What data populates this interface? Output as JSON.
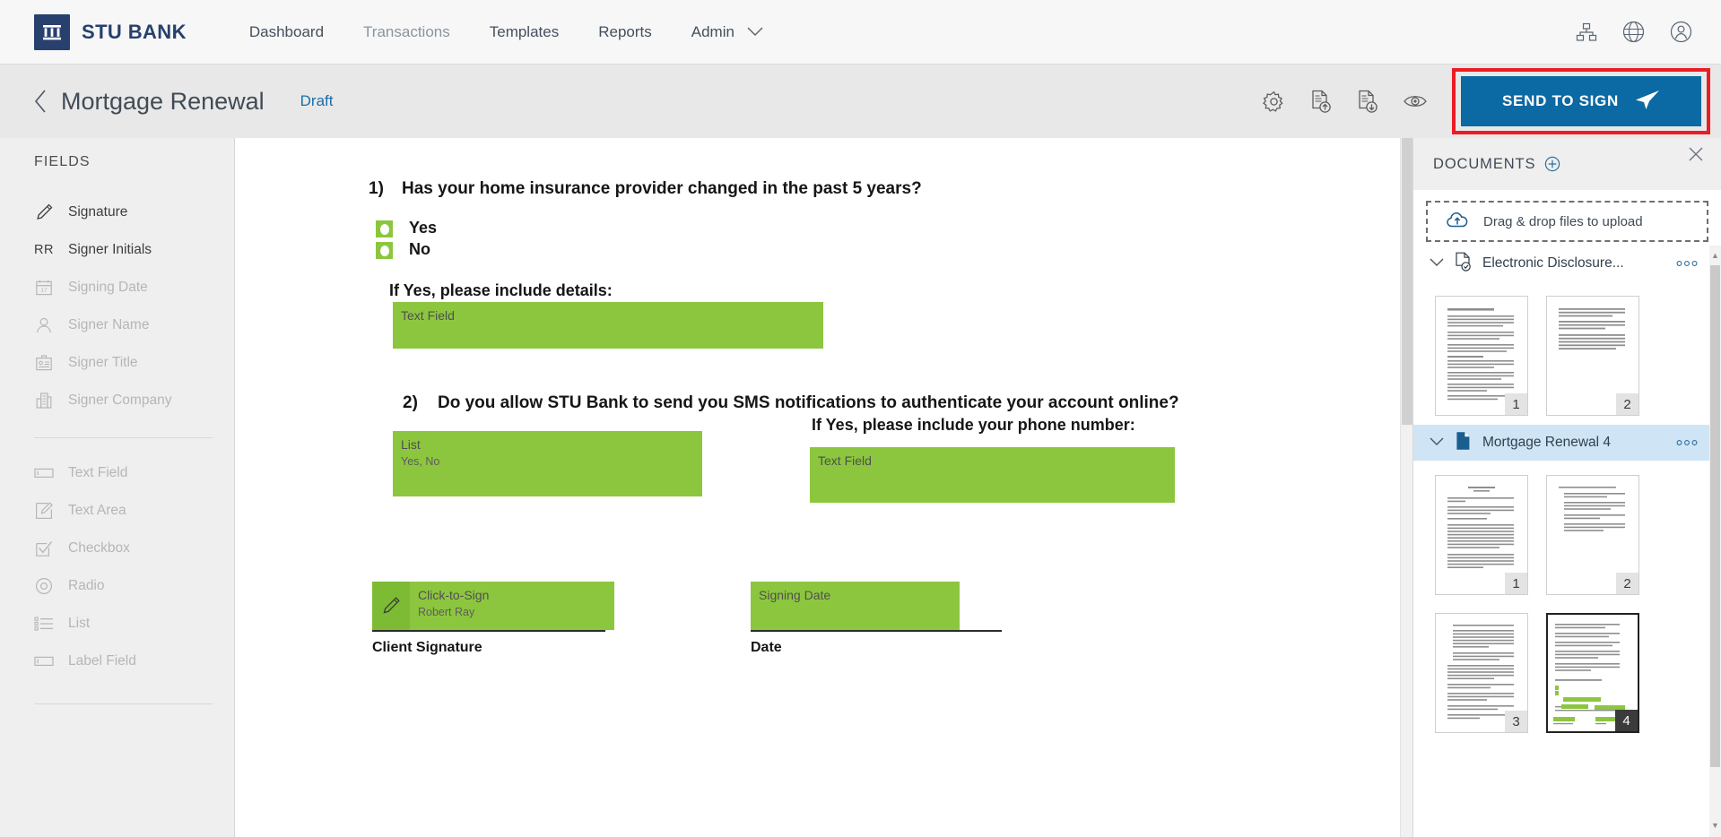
{
  "topnav": {
    "brand": "STU BANK",
    "brand_icon": "bank-columns-icon",
    "links": [
      {
        "label": "Dashboard",
        "muted": false
      },
      {
        "label": "Transactions",
        "muted": true
      },
      {
        "label": "Templates",
        "muted": false
      },
      {
        "label": "Reports",
        "muted": false
      },
      {
        "label": "Admin",
        "muted": false,
        "caret": true
      }
    ],
    "right_icons": [
      "sitemap-icon",
      "globe-icon",
      "user-avatar-icon"
    ]
  },
  "subheader": {
    "back_icon": "chevron-left-icon",
    "title": "Mortgage Renewal",
    "status": "Draft",
    "action_icons": [
      "gear-icon",
      "document-upload-icon",
      "document-download-icon",
      "eye-icon"
    ],
    "send_label": "SEND TO SIGN",
    "send_icon": "paper-plane-icon",
    "send_bg": "#0b69a3",
    "highlight_border": "#ec1c24"
  },
  "fields_panel": {
    "heading": "FIELDS",
    "groups": [
      {
        "items": [
          {
            "label": "Signature",
            "icon": "pencil-icon",
            "enabled": true
          },
          {
            "label": "Signer Initials",
            "icon": "rr-initials-icon",
            "enabled": true
          },
          {
            "label": "Signing Date",
            "icon": "calendar-icon",
            "enabled": false
          },
          {
            "label": "Signer Name",
            "icon": "person-icon",
            "enabled": false
          },
          {
            "label": "Signer Title",
            "icon": "id-badge-icon",
            "enabled": false
          },
          {
            "label": "Signer Company",
            "icon": "building-icon",
            "enabled": false
          }
        ]
      },
      {
        "items": [
          {
            "label": "Text Field",
            "icon": "text-field-icon",
            "enabled": false
          },
          {
            "label": "Text Area",
            "icon": "text-area-icon",
            "enabled": false
          },
          {
            "label": "Checkbox",
            "icon": "checkbox-icon",
            "enabled": false
          },
          {
            "label": "Radio",
            "icon": "radio-icon",
            "enabled": false
          },
          {
            "label": "List",
            "icon": "list-icon",
            "enabled": false
          },
          {
            "label": "Label Field",
            "icon": "label-field-icon",
            "enabled": false
          }
        ]
      }
    ]
  },
  "document": {
    "questions": [
      {
        "num": "1)",
        "text": "Has your home insurance provider changed in the past 5 years?"
      },
      {
        "num": "2)",
        "text": "Do you allow STU Bank to send you SMS notifications to authenticate your account online?"
      }
    ],
    "options": [
      {
        "label": "Yes"
      },
      {
        "label": "No"
      }
    ],
    "prompts": [
      "If Yes, please include details:",
      "If Yes, please include your phone number:"
    ],
    "fields": [
      {
        "type": "text-field",
        "label": "Text Field",
        "sub": ""
      },
      {
        "type": "list",
        "label": "List",
        "sub": "Yes, No"
      },
      {
        "type": "text-field",
        "label": "Text Field",
        "sub": ""
      },
      {
        "type": "signature",
        "label": "Click-to-Sign",
        "sub": "Robert Ray"
      },
      {
        "type": "signing-date",
        "label": "Signing Date",
        "sub": ""
      }
    ],
    "captions": [
      "Client Signature",
      "Date"
    ],
    "field_color": "#8cc63f"
  },
  "docs_panel": {
    "title": "DOCUMENTS",
    "add_icon": "plus-circle-icon",
    "close_icon": "close-icon",
    "dropzone_text": "Drag & drop files to upload",
    "dropzone_icon": "cloud-upload-icon",
    "documents": [
      {
        "name": "Electronic Disclosure...",
        "icon": "document-check-icon",
        "selected": false,
        "expanded": true,
        "pages": [
          {
            "num": "1",
            "selected": false
          },
          {
            "num": "2",
            "selected": false
          }
        ]
      },
      {
        "name": "Mortgage Renewal 4",
        "icon": "document-filled-icon",
        "selected": true,
        "expanded": true,
        "pages": [
          {
            "num": "1",
            "selected": false
          },
          {
            "num": "2",
            "selected": false
          },
          {
            "num": "3",
            "selected": false
          },
          {
            "num": "4",
            "selected": true
          }
        ]
      }
    ],
    "row_menu_icon": "more-dots-icon",
    "expand_icon": "chevron-down-icon",
    "selected_row_bg": "#cfe5f5"
  }
}
